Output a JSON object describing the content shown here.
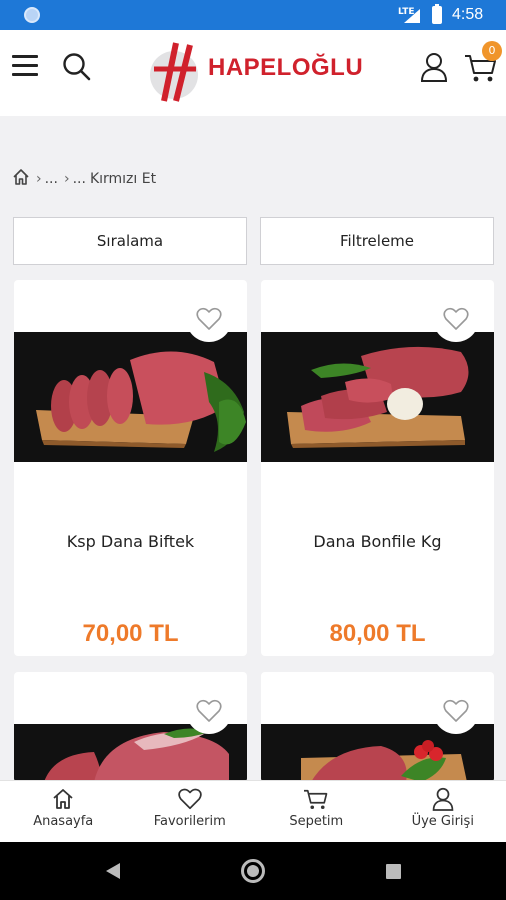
{
  "status_bar": {
    "network": "LTE",
    "time": "4:58"
  },
  "header": {
    "brand": "HAPELOĞLU",
    "cart_count": "0"
  },
  "breadcrumb": {
    "items": [
      "...",
      "...",
      "Kırmızı Et"
    ]
  },
  "filters": {
    "sort_label": "Sıralama",
    "filter_label": "Filtreleme"
  },
  "products": [
    {
      "name": "Ksp Dana Biftek",
      "price": "70,00 TL"
    },
    {
      "name": "Dana Bonfile Kg",
      "price": "80,00 TL"
    },
    {
      "name": "",
      "price": ""
    },
    {
      "name": "",
      "price": ""
    }
  ],
  "bottom_nav": [
    {
      "label": "Anasayfa",
      "icon": "home-icon"
    },
    {
      "label": "Favorilerim",
      "icon": "heart-icon"
    },
    {
      "label": "Sepetim",
      "icon": "cart-icon"
    },
    {
      "label": "Üye Girişi",
      "icon": "user-icon"
    }
  ],
  "colors": {
    "status_bar": "#1e78d7",
    "brand_red": "#d0212c",
    "price_orange": "#ee7a2a",
    "badge_orange": "#f0952b"
  }
}
